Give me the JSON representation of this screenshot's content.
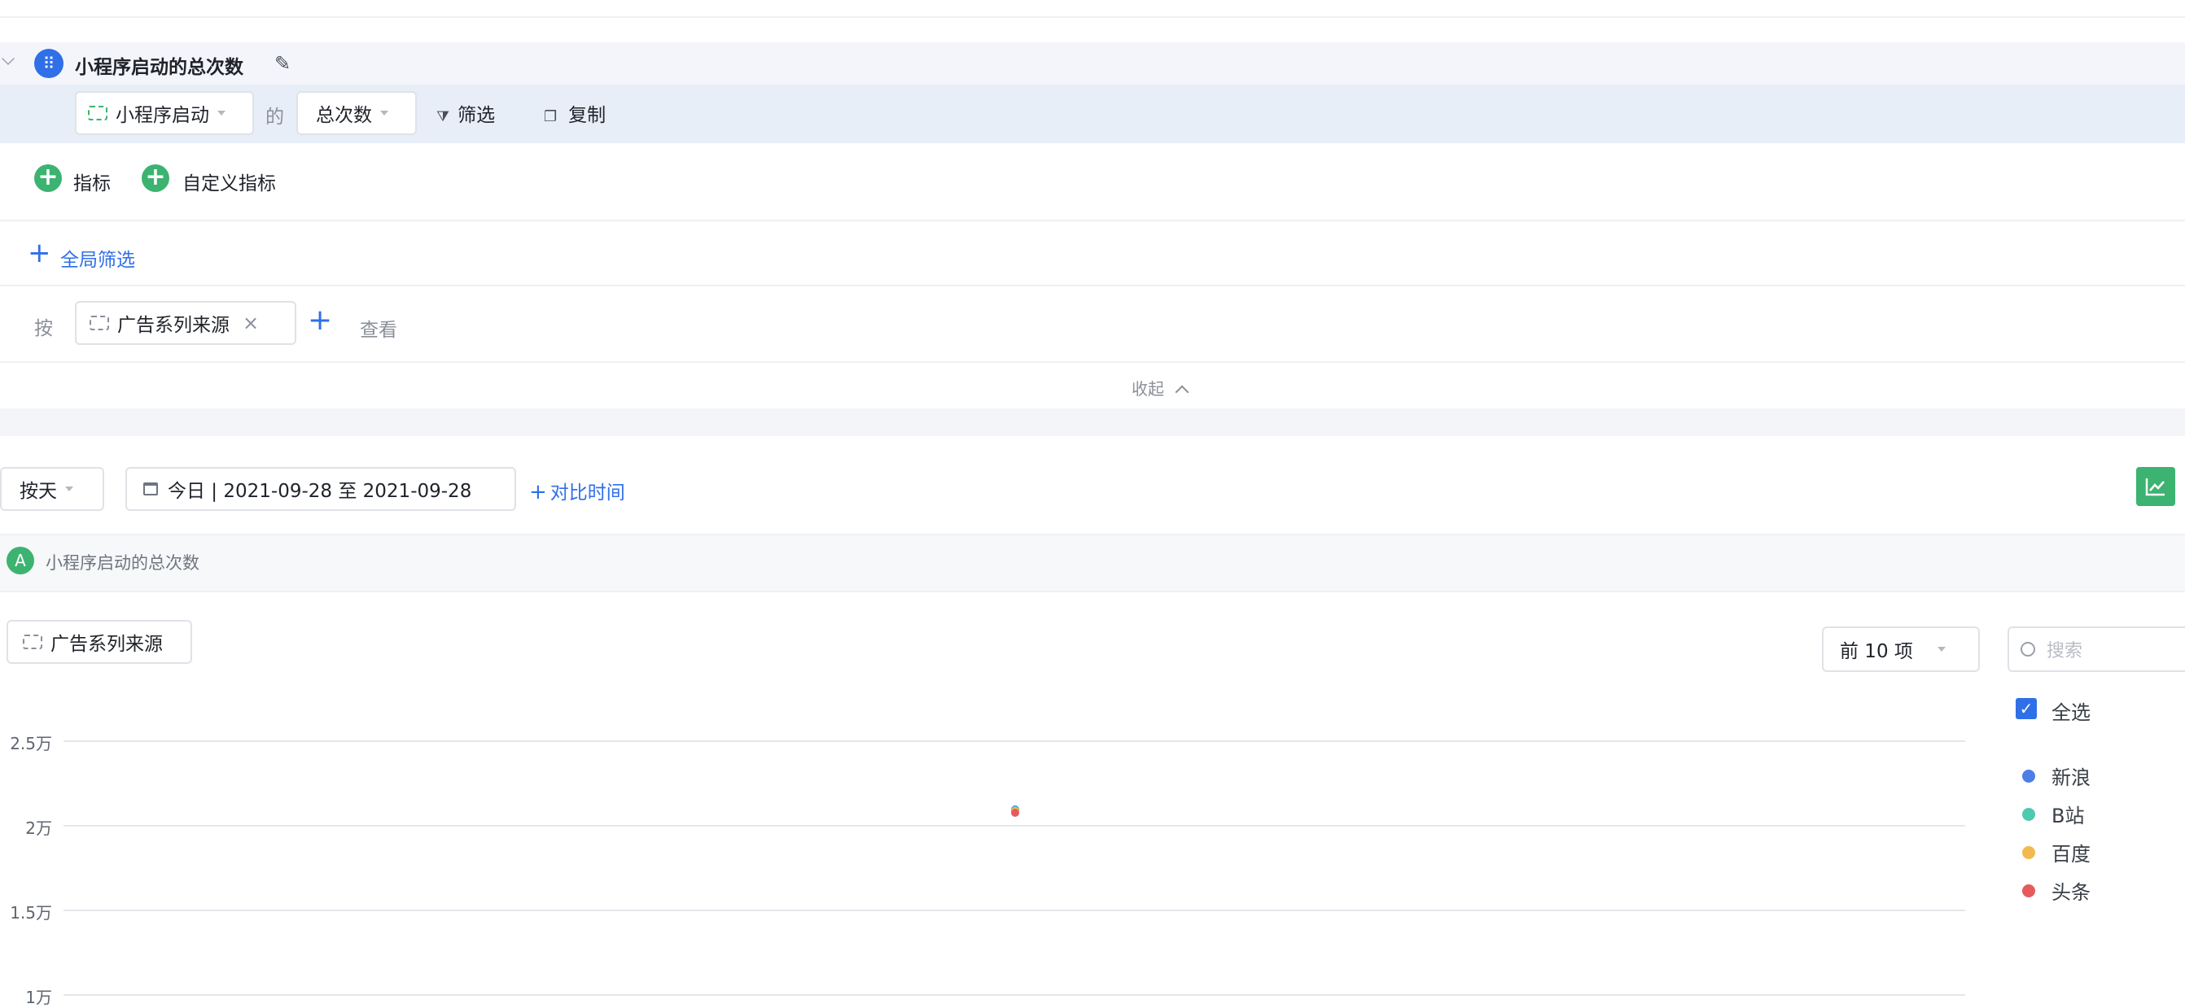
{
  "metric": {
    "title": "小程序启动的总次数",
    "event_label": "小程序启动",
    "of_label": "的",
    "agg_label": "总次数",
    "filter_label": "筛选",
    "copy_label": "复制"
  },
  "add": {
    "metric_label": "指标",
    "custom_metric_label": "自定义指标"
  },
  "global_filter_label": "全局筛选",
  "group_by": {
    "by_label": "按",
    "dimension_label": "广告系列来源",
    "view_label": "查看"
  },
  "collapse_label": "收起",
  "toolbar": {
    "granularity_label": "按天",
    "date_range_label": "今日 | 2021-09-28 至 2021-09-28",
    "compare_label": "对比时间"
  },
  "series_header": {
    "badge": "A",
    "title": "小程序启动的总次数"
  },
  "chart_controls": {
    "dimension_label": "广告系列来源",
    "topn_label": "前 10 项",
    "search_placeholder": "搜索",
    "select_all_label": "全选"
  },
  "colors": {
    "accent": "#2f6fe8",
    "green": "#3cb371",
    "新浪": "#4d7ee8",
    "B站": "#4fc9b0",
    "百度": "#f2b94f",
    "头条": "#e85a5a"
  },
  "chart_data": {
    "type": "scatter",
    "x": [
      "2021-09-28"
    ],
    "series": [
      {
        "name": "新浪",
        "values": [
          20900
        ]
      },
      {
        "name": "B站",
        "values": [
          20850
        ]
      },
      {
        "name": "百度",
        "values": [
          20800
        ]
      },
      {
        "name": "头条",
        "values": [
          20700
        ]
      }
    ],
    "yticks": [
      "2.5万",
      "2万",
      "1.5万",
      "1万"
    ],
    "ytick_values": [
      25000,
      20000,
      15000,
      10000
    ],
    "legend_position": "right"
  }
}
